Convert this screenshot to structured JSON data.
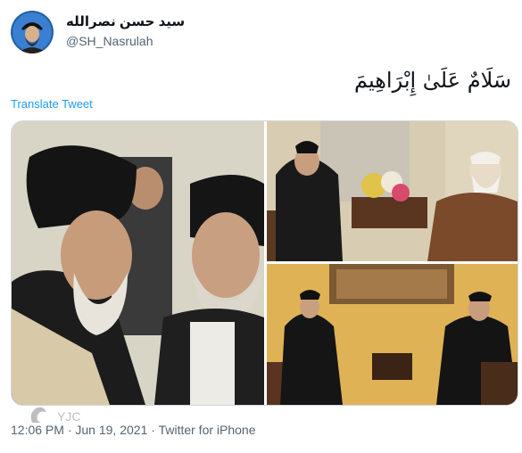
{
  "author": {
    "display_name": "سيد حسن نصرالله",
    "handle": "@SH_Nasrulah"
  },
  "tweet": {
    "text": "سَلَامٌ عَلَىٰ إِبْرَاهِيمَ",
    "translate_label": "Translate Tweet"
  },
  "meta": {
    "time": "12:06 PM",
    "separator": " · ",
    "date": "Jun 19, 2021",
    "separator2": " · ",
    "source": "Twitter for iPhone"
  },
  "watermark": {
    "text": "YJC"
  },
  "colors": {
    "link": "#1d9bf0",
    "secondary_text": "#536471",
    "primary_text": "#0f1419"
  },
  "icons": [
    "avatar-image",
    "watermark-logo-icon"
  ]
}
